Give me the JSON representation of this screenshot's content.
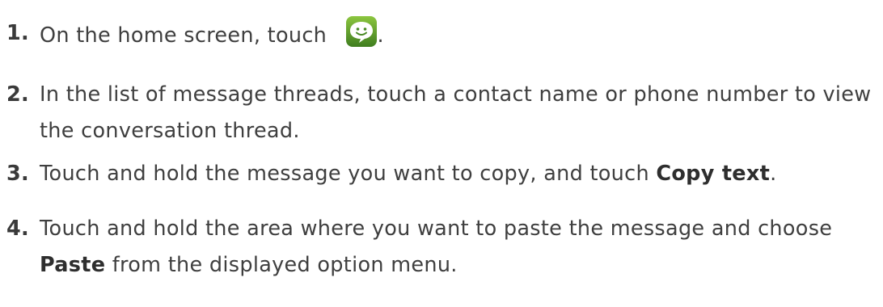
{
  "steps": [
    {
      "number": "1.",
      "text_before": "On the home screen, touch",
      "icon": "messaging-app-icon",
      "text_after": "."
    },
    {
      "number": "2.",
      "text": "In the list of message threads, touch a contact name or phone number to view the conversation thread."
    },
    {
      "number": "3.",
      "text_before": "Touch and hold the message you want to copy, and touch ",
      "bold": "Copy text",
      "text_after": "."
    },
    {
      "number": "4.",
      "text_before": "Touch and hold the area where you want to paste the message and choose ",
      "bold": "Paste",
      "text_after": " from the displayed option menu."
    }
  ],
  "colors": {
    "text": "#3f3f3f",
    "icon_green": "#5a9a2e",
    "icon_bubble": "#ffffff"
  }
}
